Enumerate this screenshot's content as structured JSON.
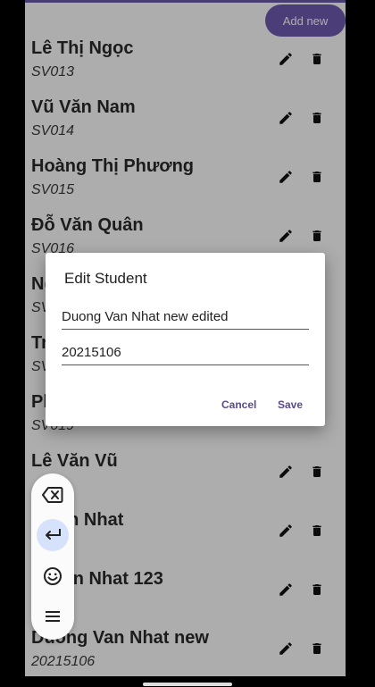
{
  "toolbar": {
    "add_label": "Add new"
  },
  "students": [
    {
      "name": "Lê Thị Ngọc",
      "code": "SV013"
    },
    {
      "name": "Vũ Văn Nam",
      "code": "SV014"
    },
    {
      "name": "Hoàng Thị Phương",
      "code": "SV015"
    },
    {
      "name": "Đỗ Văn Quân",
      "code": "SV016"
    },
    {
      "name": "Ng",
      "code": "SV"
    },
    {
      "name": "Tr",
      "code": "SV"
    },
    {
      "name": "Ph",
      "code": "SV019"
    },
    {
      "name": "Lê Văn Vũ",
      "code": ""
    },
    {
      "name": "g Van Nhat",
      "code": "106"
    },
    {
      "name": "g  Van Nhat 123",
      "code": "106"
    },
    {
      "name": "Duong Van Nhat new",
      "code": "20215106"
    }
  ],
  "dialog": {
    "title": "Edit Student",
    "name_value": "Duong Van Nhat new edited",
    "code_value": "20215106",
    "cancel_label": "Cancel",
    "save_label": "Save"
  },
  "floating_toolbar": {
    "items": [
      "backspace-icon",
      "enter-icon",
      "emoji-icon",
      "menu-icon"
    ],
    "selected": "enter-icon"
  },
  "colors": {
    "accent": "#6f5bb0",
    "dialog_button": "#5a4a95",
    "selected_highlight": "#d6e2fb"
  }
}
